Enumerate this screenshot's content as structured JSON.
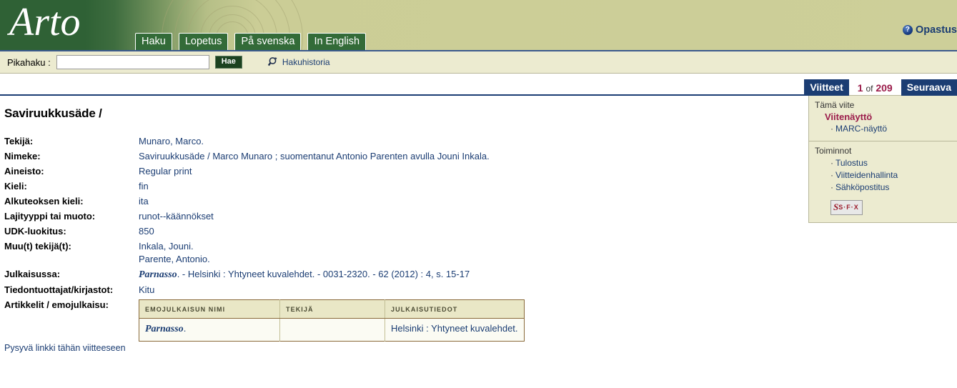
{
  "header": {
    "logo": "Arto",
    "tabs": [
      {
        "label": "Haku"
      },
      {
        "label": "Lopetus"
      },
      {
        "label": "På svenska"
      },
      {
        "label": "In English"
      }
    ],
    "help": {
      "label": "Opastus",
      "icon": "question-mark-icon"
    }
  },
  "quicksearch": {
    "label": "Pikahaku :",
    "value": "",
    "placeholder": "",
    "submit_label": "Hae",
    "history_label": "Hakuhistoria",
    "history_icon": "magnifier-icon"
  },
  "pager": {
    "results_label": "Viitteet",
    "current": "1",
    "of": "of",
    "total": "209",
    "next_label": "Seuraava"
  },
  "sidebar": {
    "this_record": {
      "title": "Tämä viite",
      "current": "Viitenäyttö",
      "links": [
        {
          "label": "MARC-näyttö"
        }
      ]
    },
    "actions": {
      "title": "Toiminnot",
      "links": [
        {
          "label": "Tulostus"
        },
        {
          "label": "Viitteidenhallinta"
        },
        {
          "label": "Sähköpostitus"
        }
      ],
      "sfx_label": "S·F·X",
      "sfx_mark": "S"
    }
  },
  "record": {
    "title": "Saviruukkusäde /",
    "fields": [
      {
        "key": "Tekijä:",
        "values": [
          "Munaro, Marco."
        ]
      },
      {
        "key": "Nimeke:",
        "values": [
          "Saviruukkusäde / Marco Munaro ; suomentanut Antonio Parenten avulla Jouni Inkala."
        ]
      },
      {
        "key": "Aineisto:",
        "values": [
          "Regular print"
        ]
      },
      {
        "key": "Kieli:",
        "values": [
          "fin"
        ]
      },
      {
        "key": "Alkuteoksen kieli:",
        "values": [
          "ita"
        ]
      },
      {
        "key": "Lajityyppi tai muoto:",
        "values": [
          "runot--käännökset"
        ]
      },
      {
        "key": "UDK-luokitus:",
        "values": [
          "850"
        ]
      },
      {
        "key": "Muu(t) tekijä(t):",
        "values": [
          "Inkala, Jouni.",
          "Parente, Antonio."
        ]
      }
    ],
    "published_in": {
      "key": "Julkaisussa:",
      "journal": "Parnasso",
      "rest": ". - Helsinki : Yhtyneet kuvalehdet. - 0031-2320. - 62 (2012) : 4, s. 15-17"
    },
    "providers": {
      "key": "Tiedontuottajat/kirjastot:",
      "value": "Kitu"
    },
    "articles": {
      "key": "Artikkelit / emojulkaisu:",
      "columns": [
        "Emojulkaisun nimi",
        "Tekijä",
        "Julkaisutiedot"
      ],
      "rows": [
        {
          "name": "Parnasso",
          "name_suffix": ".",
          "author": "",
          "pubinfo": "Helsinki : Yhtyneet kuvalehdet."
        }
      ]
    },
    "permalink": "Pysyvä linkki tähän viitteeseen"
  },
  "colors": {
    "header_green": "#2f6135",
    "header_tan": "#cdcf99",
    "navy": "#1b3d73",
    "crimson": "#9b1b4a",
    "panel_bg": "#ecebd0"
  }
}
